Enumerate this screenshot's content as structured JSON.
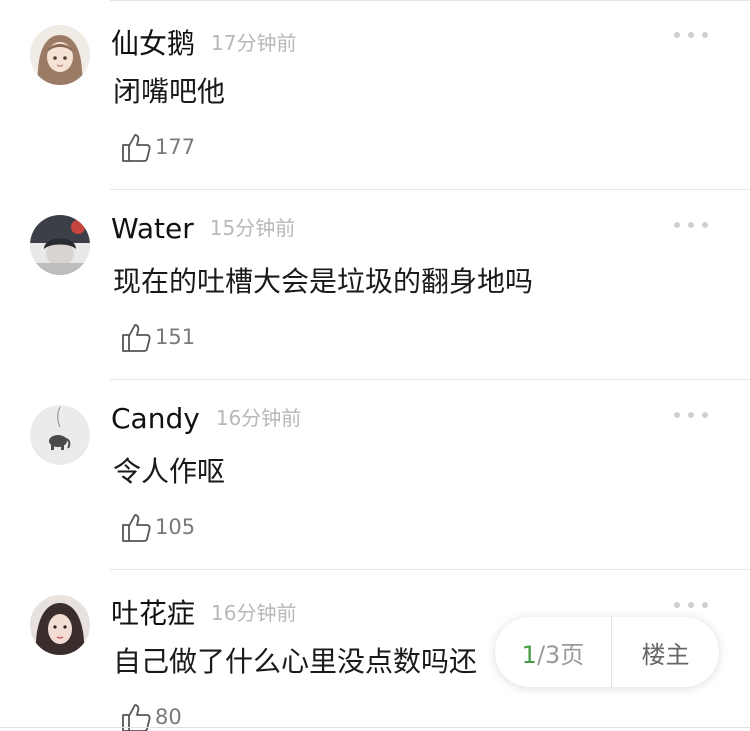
{
  "comments": [
    {
      "user": "仙女鹅",
      "time": "17分钟前",
      "text": "闭嘴吧他",
      "likes": "177",
      "avatar_icon": "girl-avatar-icon"
    },
    {
      "user": "Water",
      "time": "15分钟前",
      "text": "现在的吐槽大会是垃圾的翻身地吗",
      "likes": "151",
      "avatar_icon": "photo-avatar-icon"
    },
    {
      "user": "Candy",
      "time": "16分钟前",
      "text": "令人作呕",
      "likes": "105",
      "avatar_icon": "elephant-avatar-icon"
    },
    {
      "user": "吐花症",
      "time": "16分钟前",
      "text": "自己做了什么心里没点数吗还",
      "likes": "80",
      "avatar_icon": "girl-photo-avatar-icon"
    }
  ],
  "pager": {
    "current": "1",
    "total_label": "/3页",
    "host_label": "楼主"
  },
  "colors": {
    "accent": "#4a9b45",
    "time": "#b8b8b8",
    "divider": "#e6e6e6"
  }
}
